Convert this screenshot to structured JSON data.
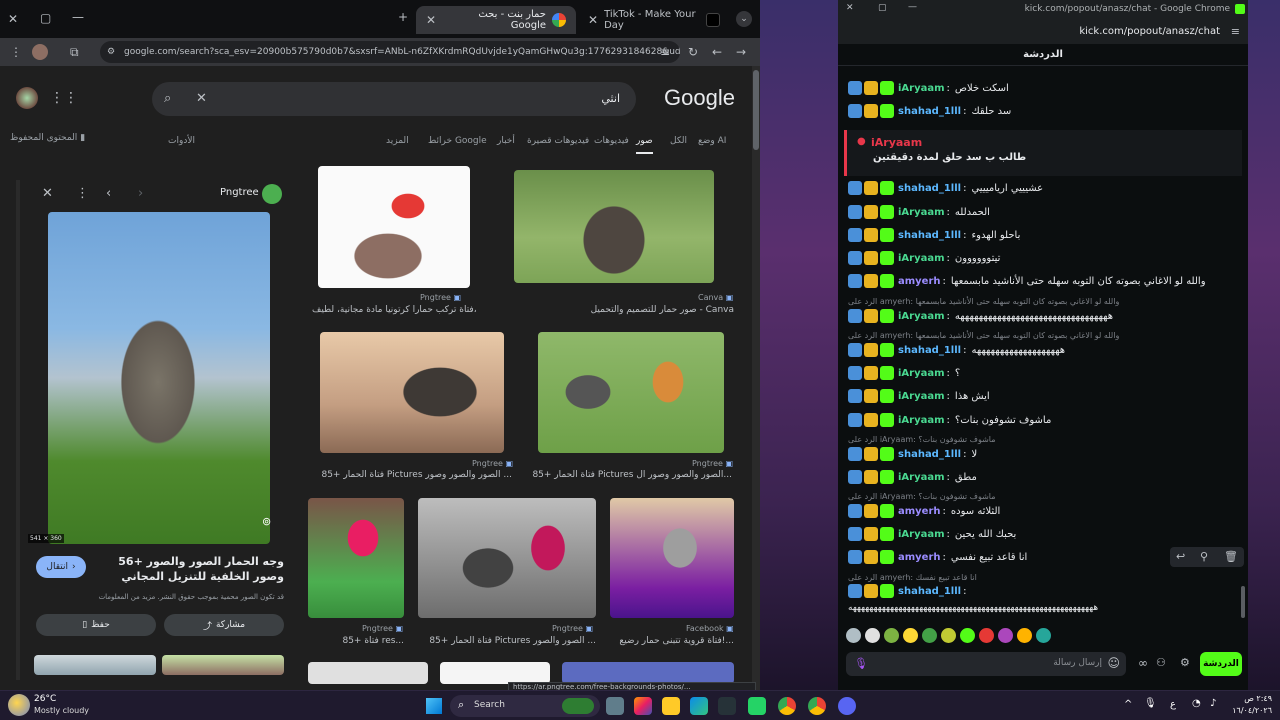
{
  "browser": {
    "tabs": [
      {
        "label": "حمار بنت - بحث Google"
      },
      {
        "label": "TikTok - Make Your Day"
      }
    ],
    "url": "google.com/search?sca_esv=20900b575790d0b7&sxsrf=ANbL-n6ZfXKrdmRQdUvjde1yQamGHwQu3g:1776293184628&udm=...",
    "status_url": "https://ar.pngtree.com/free-backgrounds-photos/..."
  },
  "google": {
    "logo": "Google",
    "query": "انثي",
    "nav": [
      "وضع AI",
      "الكل",
      "صور",
      "فيديوهات",
      "فيديوهات قصيرة",
      "أخبار",
      "خرائط Google",
      "المزيد",
      "الأدوات"
    ],
    "saved": "المحتوى المحفوظ",
    "side": {
      "source": "Pngtree",
      "dims": "541 × 360",
      "title": "56+ وجه الحمار الصور والصور وصور الخلفية للتنزيل المجاني",
      "visit": "انتقال",
      "note": "قد تكون الصور محمية بموجب حقوق النشر. مزيد من المعلومات",
      "share": "مشاركة",
      "save": "حفظ"
    },
    "results": [
      {
        "source": "Pngtree",
        "caption": "فتاة تركب حماراً كرتونياً مادة مجانية، لطيف، ..."
      },
      {
        "source": "Canva",
        "caption": "صور حمار للتصميم والتحميل - Canva"
      },
      {
        "source": "Pngtree",
        "caption": "85+ فتاة الحمار Pictures الصور والصور وصور ..."
      },
      {
        "source": "Pngtree",
        "caption": "85+ فتاة الحمار Pictures الصور والصور وصور ال..."
      },
      {
        "source": "Pngtree",
        "caption": "85+ فتاة res..."
      },
      {
        "source": "Pngtree",
        "caption": "85+ فتاة الحمار Pictures الصور والصور ..."
      },
      {
        "source": "Facebook",
        "caption": "فتاة قروية تتبنى حمار رضيع!..."
      }
    ]
  },
  "kick": {
    "title": "kick.com/popout/anasz/chat - Google Chrome",
    "url": "kick.com/popout/anasz/chat",
    "header": "الدردشة",
    "pinned": {
      "user": "iAryaam",
      "text": "طالب ب سد حلق لمدة دقيقتين"
    },
    "messages": [
      {
        "user": "iAryaam",
        "color": "#4ad991",
        "text": "اسكت خلاص"
      },
      {
        "user": "shahad_1lll",
        "color": "#5cb8ff",
        "text": "سد حلقك"
      },
      {
        "user": "shahad_1lll",
        "color": "#5cb8ff",
        "text": "عشيييي ارياميييي"
      },
      {
        "user": "iAryaam",
        "color": "#4ad991",
        "text": "الحمدلله"
      },
      {
        "user": "shahad_1lll",
        "color": "#5cb8ff",
        "text": "باحلو الهدوء"
      },
      {
        "user": "iAryaam",
        "color": "#4ad991",
        "text": "تيتوووووون"
      },
      {
        "user": "amyerh",
        "color": "#9b8cff",
        "text": "والله لو الاغاني بصوته كان التوبه سهله حتى الأناشيد مابسمعها"
      },
      {
        "user": "iAryaam",
        "color": "#4ad991",
        "text": "هههههههههههههههههههههههههههههههههه"
      },
      {
        "user": "shahad_1lll",
        "color": "#5cb8ff",
        "text": "هههههههههههههههههههه"
      },
      {
        "user": "iAryaam",
        "color": "#4ad991",
        "text": "؟"
      },
      {
        "user": "iAryaam",
        "color": "#4ad991",
        "text": "ايش هذا"
      },
      {
        "user": "iAryaam",
        "color": "#4ad991",
        "text": "ماشوف تشوفون بنات؟"
      },
      {
        "user": "shahad_1lll",
        "color": "#5cb8ff",
        "text": "لا"
      },
      {
        "user": "iAryaam",
        "color": "#4ad991",
        "text": "مطق"
      },
      {
        "user": "amyerh",
        "color": "#9b8cff",
        "text": "الثلاثه سوده"
      },
      {
        "user": "iAryaam",
        "color": "#4ad991",
        "text": "بحبك الله يحين"
      },
      {
        "user": "amyerh",
        "color": "#9b8cff",
        "text": "انا قاعد تبيع نفسي"
      },
      {
        "user": "shahad_1lll",
        "color": "#5cb8ff",
        "text": ""
      }
    ],
    "replies": [
      "الرد على amyerh: والله لو الاغاني بصوته كان التوبه سهله حتى الأناشيد مابسمعها",
      "الرد على amyerh: والله لو الاغاني بصوته كان التوبه سهله حتى الأناشيد مابسمعها",
      "الرد على iAryaam: ماشوف تشوفون بنات؟",
      "الرد على iAryaam: ماشوف تشوفون بنات؟",
      "الرد على amyerh: انا قاعد تبيع نفسك"
    ],
    "last_text": "هههههههههههههههههههههههههههههههههههههههههههههههههههههههههههه",
    "input_placeholder": "إرسال رسالة",
    "send": "الدردشة"
  },
  "taskbar": {
    "weather_temp": "26°C",
    "weather_desc": "Mostly cloudy",
    "search": "Search",
    "lang": "ع",
    "time": "٢:٤٩ ص",
    "date": "١٦/٠٤/٢٠٢٦"
  }
}
